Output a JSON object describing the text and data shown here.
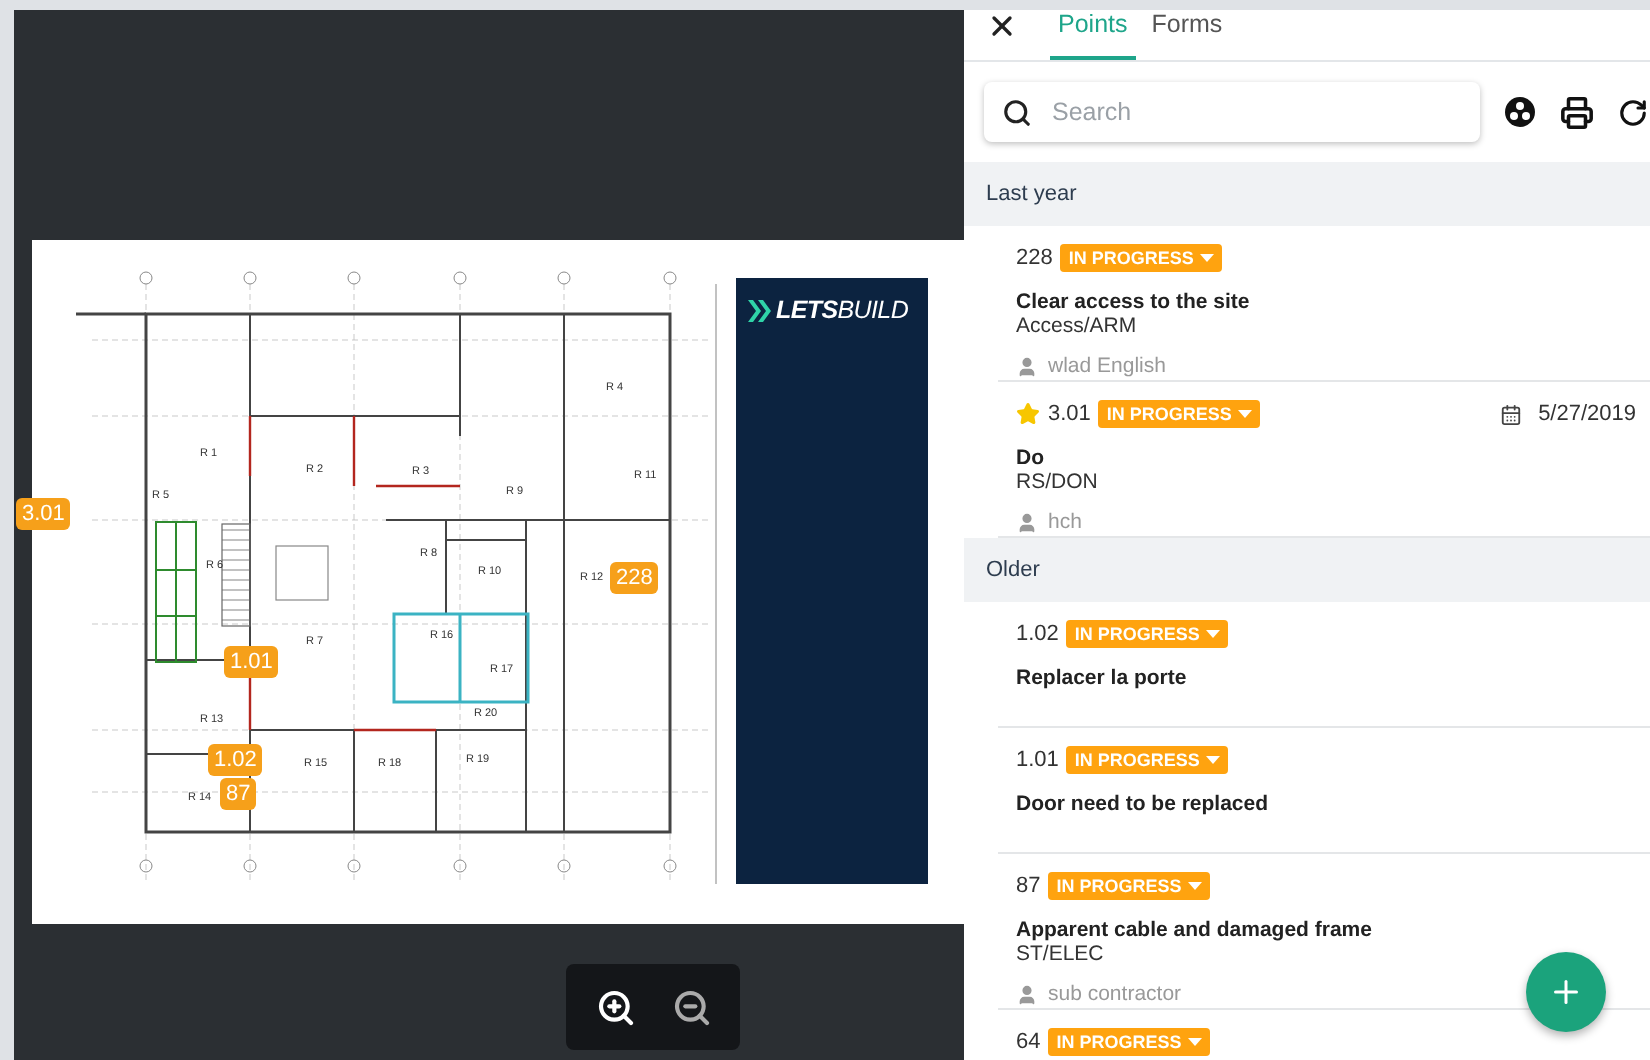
{
  "plan": {
    "logo": "**LETS**BUILD",
    "rooms": [
      "R 1",
      "R 2",
      "R 3",
      "R 4",
      "R 5",
      "R 6",
      "R 7",
      "R 8",
      "R 9",
      "R 10",
      "R 11",
      "R 12",
      "R 13",
      "R 14",
      "R 15",
      "R 16",
      "R 17",
      "R 18",
      "R 19",
      "R 20"
    ],
    "pins": [
      "3.01",
      "228",
      "1.01",
      "1.02",
      "87"
    ]
  },
  "panel": {
    "tabs": [
      {
        "label": "Points",
        "selected": true
      },
      {
        "label": "Forms",
        "selected": false
      }
    ],
    "search": {
      "placeholder": "Search"
    },
    "sections": [
      {
        "label": "Last year",
        "points": [
          {
            "number": "228",
            "starred": false,
            "status": "IN PROGRESS",
            "title": "Clear access to the site",
            "subtitle": "Access/ARM",
            "assignee": "wlad English"
          },
          {
            "number": "3.01",
            "starred": true,
            "status": "IN PROGRESS",
            "title": "Do",
            "subtitle": "RS/DON",
            "assignee": "hch",
            "date": "5/27/2019"
          }
        ]
      },
      {
        "label": "Older",
        "points": [
          {
            "number": "1.02",
            "starred": false,
            "status": "IN PROGRESS",
            "title": "Replacer la porte"
          },
          {
            "number": "1.01",
            "starred": false,
            "status": "IN PROGRESS",
            "title": "Door need to be replaced"
          },
          {
            "number": "87",
            "starred": false,
            "status": "IN PROGRESS",
            "title": "Apparent cable and damaged frame",
            "subtitle": "ST/ELEC",
            "assignee": "sub contractor"
          },
          {
            "number": "64",
            "starred": false,
            "status": "IN PROGRESS"
          }
        ]
      }
    ]
  }
}
